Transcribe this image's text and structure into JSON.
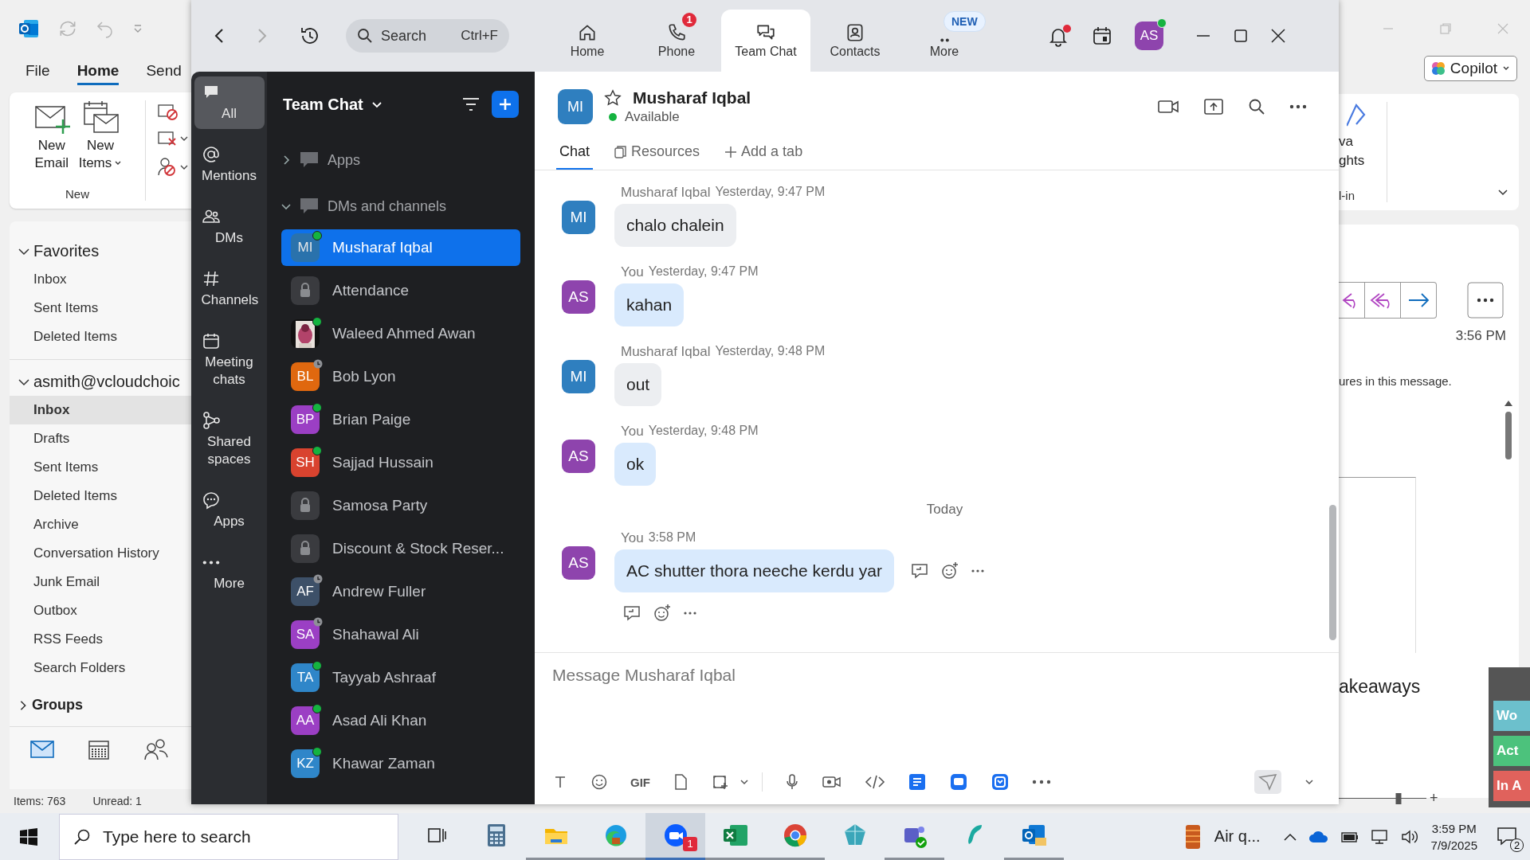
{
  "outlook": {
    "menu_tabs": [
      {
        "label": "File",
        "selected": false
      },
      {
        "label": "Home",
        "selected": true
      },
      {
        "label": "Send",
        "selected": false
      }
    ],
    "ribbon": {
      "buttons": [
        {
          "label_lines": [
            "New",
            "Email"
          ],
          "dropdown": false
        },
        {
          "label_lines": [
            "New",
            "Items"
          ],
          "dropdown": true
        }
      ],
      "group_label": "New"
    },
    "favorites": {
      "label": "Favorites",
      "expanded": true,
      "items": [
        {
          "label": "Inbox",
          "selected": false
        },
        {
          "label": "Sent Items",
          "selected": false
        },
        {
          "label": "Deleted Items",
          "selected": false
        }
      ]
    },
    "account": {
      "label": "asmith@vcloudchoic",
      "expanded": true,
      "items": [
        {
          "label": "Inbox",
          "selected": true
        },
        {
          "label": "Drafts",
          "selected": false
        },
        {
          "label": "Sent Items",
          "selected": false
        },
        {
          "label": "Deleted Items",
          "selected": false
        },
        {
          "label": "Archive",
          "selected": false
        },
        {
          "label": "Conversation History",
          "selected": false
        },
        {
          "label": "Junk Email",
          "selected": false
        },
        {
          "label": "Outbox",
          "selected": false
        },
        {
          "label": "RSS Feeds",
          "selected": false
        },
        {
          "label": "Search Folders",
          "selected": false
        }
      ]
    },
    "groups": {
      "label": "Groups",
      "expanded": false
    },
    "status_bar": {
      "items": "Items: 763",
      "unread": "Unread: 1"
    },
    "right": {
      "copilot": "Copilot",
      "ribbon_label_lines": [
        "va",
        "ghts"
      ],
      "ribbon_group": "l-in",
      "time": "3:56 PM",
      "info": "ures in this message.",
      "heading": "akeaways",
      "zoom_in": "+",
      "zoom_slider": {
        "level": 0.68
      },
      "tags": [
        {
          "label": "Wo",
          "color": "#6cc0cc"
        },
        {
          "label": "Act",
          "color": "#4cc27c"
        },
        {
          "label": "In A",
          "color": "#e0625c"
        }
      ]
    }
  },
  "zoom": {
    "search": {
      "placeholder": "Search",
      "shortcut": "Ctrl+F"
    },
    "nav_tabs": [
      {
        "label": "Home",
        "selected": false
      },
      {
        "label": "Phone",
        "selected": false,
        "badge": {
          "kind": "count",
          "text": "1"
        }
      },
      {
        "label": "Team Chat",
        "selected": true
      },
      {
        "label": "Contacts",
        "selected": false
      },
      {
        "label": "More",
        "selected": false,
        "badge": {
          "kind": "new",
          "text": "NEW"
        }
      }
    ],
    "notifications_unread": true,
    "profile": {
      "initials": "AS",
      "online": true
    },
    "rail": [
      {
        "label": "All",
        "selected": true
      },
      {
        "label": "Mentions",
        "selected": false
      },
      {
        "label": "DMs",
        "selected": false
      },
      {
        "label": "Channels",
        "selected": false
      },
      {
        "label": "Meeting chats",
        "selected": false
      },
      {
        "label": "Shared spaces",
        "selected": false
      },
      {
        "label": "Apps",
        "selected": false
      },
      {
        "label": "More",
        "selected": false
      }
    ],
    "list": {
      "title": "Team Chat",
      "sections": [
        {
          "label": "Apps",
          "expanded": false
        },
        {
          "label": "DMs and channels",
          "expanded": true
        }
      ],
      "items": [
        {
          "kind": "person",
          "name": "Musharaf Iqbal",
          "initials": "MI",
          "color": "#2f7fbf",
          "online": true,
          "selected": true
        },
        {
          "kind": "channel",
          "name": "Attendance",
          "selected": false
        },
        {
          "name": "Waleed Ahmed Awan",
          "online": true,
          "selected": false
        },
        {
          "kind": "person",
          "name": "Bob Lyon",
          "initials": "BL",
          "color": "#e0680f",
          "online": false,
          "selected": false
        },
        {
          "kind": "person",
          "name": "Brian Paige",
          "initials": "BP",
          "color": "#9b3fc4",
          "online": true,
          "selected": false
        },
        {
          "kind": "person",
          "name": "Sajjad Hussain",
          "initials": "SH",
          "color": "#d9432f",
          "online": true,
          "selected": false
        },
        {
          "kind": "channel",
          "name": "Samosa Party",
          "selected": false
        },
        {
          "kind": "channel",
          "name": "Discount & Stock Reser...",
          "selected": false
        },
        {
          "kind": "person",
          "name": "Andrew Fuller",
          "initials": "AF",
          "color": "#3d5068",
          "online": false,
          "selected": false
        },
        {
          "kind": "person",
          "name": "Shahawal Ali",
          "initials": "SA",
          "color": "#9b3fc4",
          "online": false,
          "selected": false
        },
        {
          "kind": "person",
          "name": "Tayyab Ashraaf",
          "initials": "TA",
          "color": "#2f86c9",
          "online": true,
          "selected": false
        },
        {
          "kind": "person",
          "name": "Asad Ali Khan",
          "initials": "AA",
          "color": "#9b3fc4",
          "online": true,
          "selected": false
        },
        {
          "kind": "person",
          "name": "Khawar Zaman",
          "initials": "KZ",
          "color": "#2f86c9",
          "online": true,
          "selected": false
        }
      ]
    },
    "chat": {
      "name": "Musharaf Iqbal",
      "initials": "MI",
      "status": "Available",
      "favorite": false,
      "tabs": [
        {
          "label": "Chat",
          "selected": true
        },
        {
          "label": "Resources",
          "selected": false
        },
        {
          "label": "Add a tab",
          "selected": false
        }
      ],
      "messages": [
        {
          "kind": "message",
          "sender": "Musharaf Iqbal",
          "initials": "MI",
          "color": "#2f7fbf",
          "own": false,
          "time": "Yesterday, 9:47 PM",
          "text": "chalo chalein"
        },
        {
          "kind": "message",
          "sender": "You",
          "initials": "AS",
          "color": "#8e44ad",
          "own": true,
          "time": "Yesterday, 9:47 PM",
          "text": "kahan"
        },
        {
          "kind": "message",
          "sender": "Musharaf Iqbal",
          "initials": "MI",
          "color": "#2f7fbf",
          "own": false,
          "time": "Yesterday, 9:48 PM",
          "text": "out"
        },
        {
          "kind": "message",
          "sender": "You",
          "initials": "AS",
          "color": "#8e44ad",
          "own": true,
          "time": "Yesterday, 9:48 PM",
          "text": "ok"
        },
        {
          "kind": "divider",
          "label": "Today"
        },
        {
          "kind": "message",
          "sender": "You",
          "initials": "AS",
          "color": "#8e44ad",
          "own": true,
          "time": "3:58 PM",
          "text": "AC shutter thora neeche kerdu yar",
          "hovered": true
        }
      ],
      "composer": {
        "placeholder": "Message Musharaf Iqbal",
        "gif_label": "GIF"
      }
    }
  },
  "taskbar": {
    "search_placeholder": "Type here to search",
    "apps": [
      {
        "kind": "task-view",
        "open": false,
        "selected": false
      },
      {
        "kind": "calculator",
        "open": false,
        "selected": false
      },
      {
        "kind": "explorer",
        "open": true,
        "selected": false
      },
      {
        "kind": "edge",
        "open": true,
        "selected": false
      },
      {
        "kind": "zoom",
        "open": true,
        "selected": true,
        "badge": "1"
      },
      {
        "kind": "excel",
        "open": true,
        "selected": false
      },
      {
        "kind": "chrome",
        "open": true,
        "selected": false
      },
      {
        "kind": "gem",
        "open": false,
        "selected": false
      },
      {
        "kind": "teams",
        "open": true,
        "selected": false
      },
      {
        "kind": "surfshark",
        "open": false,
        "selected": false
      },
      {
        "kind": "outlook",
        "open": true,
        "selected": false
      }
    ],
    "weather": "Air q...",
    "time": "3:59 PM",
    "date": "7/9/2025",
    "notifications": "2"
  }
}
